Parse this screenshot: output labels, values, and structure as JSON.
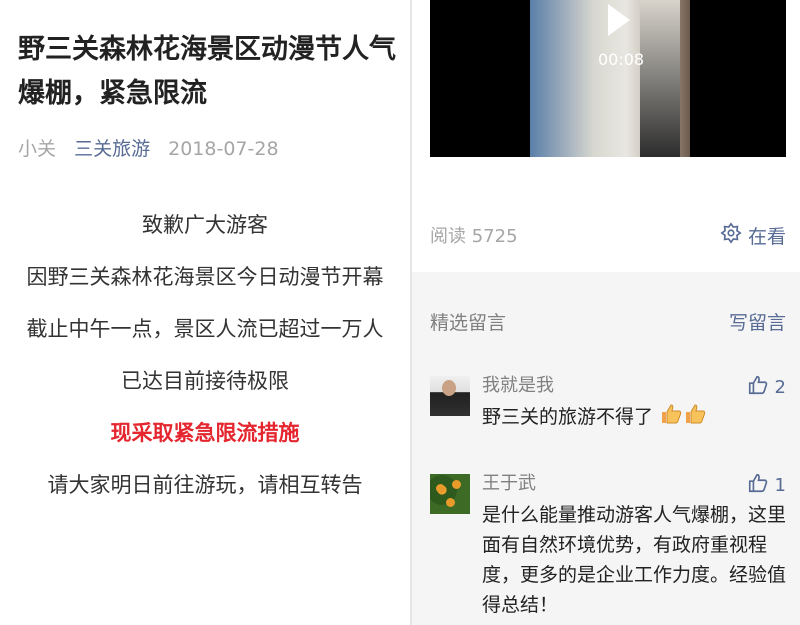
{
  "article": {
    "title": "野三关森林花海景区动漫节人气爆棚，紧急限流",
    "author": "小关",
    "account": "三关旅游",
    "date": "2018-07-28",
    "paragraphs": [
      {
        "text": "致歉广大游客",
        "highlight": false
      },
      {
        "text": "因野三关森林花海景区今日动漫节开幕",
        "highlight": false
      },
      {
        "text": "截止中午一点，景区人流已超过一万人",
        "highlight": false
      },
      {
        "text": "已达目前接待极限",
        "highlight": false
      },
      {
        "text": "现采取紧急限流措施",
        "highlight": true
      },
      {
        "text": "请大家明日前往游玩，请相互转告",
        "highlight": false
      }
    ]
  },
  "video": {
    "time": "00:08",
    "play_icon": "play-icon"
  },
  "stats": {
    "read_label": "阅读 5725",
    "wow_label": "在看",
    "wow_icon": "wow-icon"
  },
  "comments_section": {
    "header": "精选留言",
    "write_label": "写留言",
    "items": [
      {
        "name": "我就是我",
        "likes": "2",
        "text": "野三关的旅游不得了",
        "emojis": 2
      },
      {
        "name": "王于武",
        "likes": "1",
        "text": "是什么能量推动游客人气爆棚，这里面有自然环境优势，有政府重视程度，更多的是企业工作力度。经验值得总结！"
      }
    ]
  },
  "colors": {
    "link": "#576b95",
    "alert": "#e5262f",
    "muted": "#a6a6a6"
  }
}
